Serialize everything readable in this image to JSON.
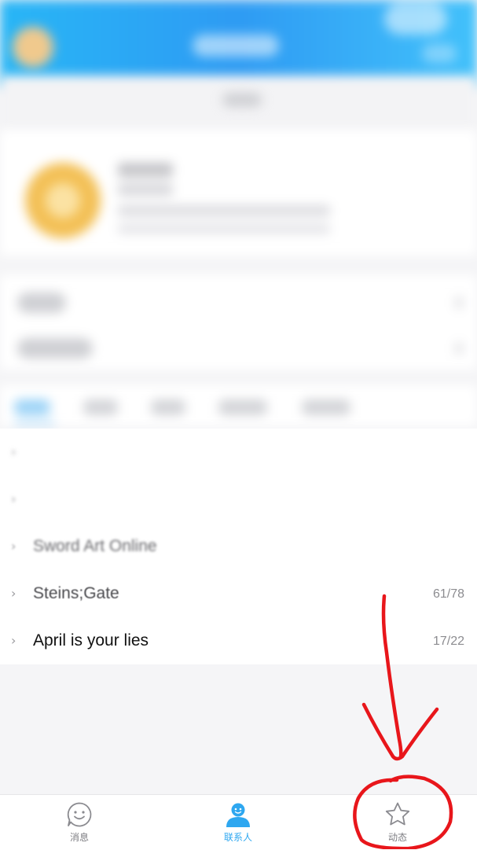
{
  "list": {
    "items": [
      {
        "title": "",
        "count": ""
      },
      {
        "title": "",
        "count": ""
      },
      {
        "title": "Sword Art Online",
        "count": ""
      },
      {
        "title": "Steins;Gate",
        "count": "61/78"
      },
      {
        "title": "April is your lies",
        "count": "17/22"
      }
    ]
  },
  "bottom_nav": {
    "items": [
      {
        "label": "消息",
        "icon": "smiley-chat-icon"
      },
      {
        "label": "联系人",
        "icon": "contacts-person-icon",
        "active": true
      },
      {
        "label": "动态",
        "icon": "star-icon"
      }
    ]
  },
  "colors": {
    "header_gradient_start": "#28b6f6",
    "header_gradient_end": "#42c1fb",
    "active_blue": "#2ea7f0",
    "annotation_red": "#e8161b"
  }
}
